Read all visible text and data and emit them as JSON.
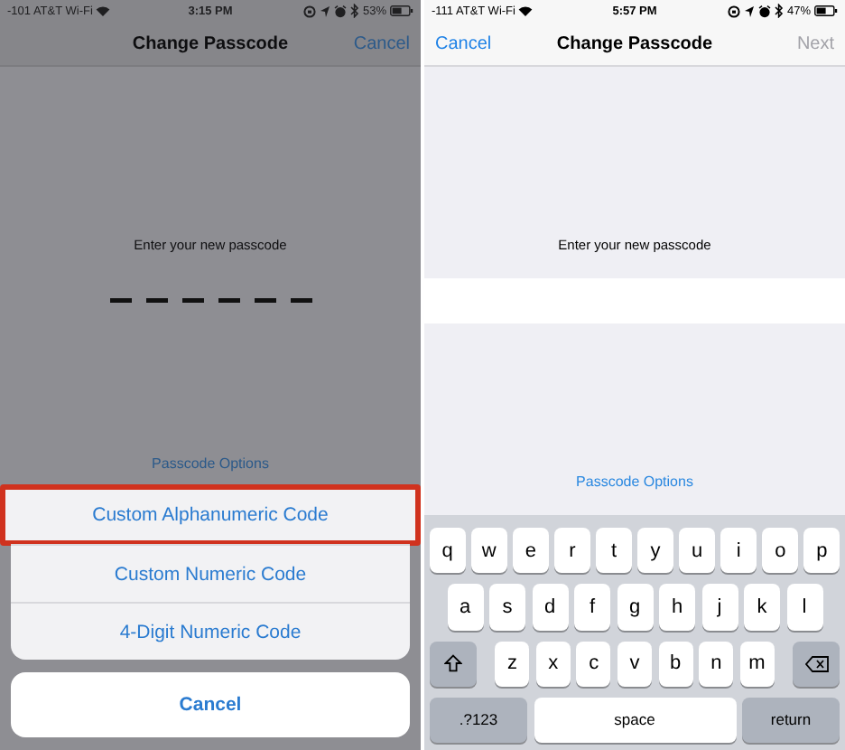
{
  "screens": [
    {
      "dimmed": true,
      "status_bar": {
        "carrier": "-101 AT&T Wi-Fi",
        "time": "3:15 PM",
        "battery": "53%",
        "icons": [
          {
            "kind": "rotation-lock"
          },
          {
            "kind": "location"
          },
          {
            "kind": "alarm"
          },
          {
            "kind": "bluetooth"
          }
        ]
      },
      "nav": {
        "title": "Change Passcode",
        "right_button": {
          "label": "Cancel",
          "disabled": false
        }
      },
      "prompt": "Enter your new passcode",
      "options_link": "Passcode Options",
      "action_sheet": {
        "options": [
          {
            "label": "Custom Alphanumeric Code",
            "highlighted": true
          },
          {
            "label": "Custom Numeric Code",
            "highlighted": false
          },
          {
            "label": "4-Digit Numeric Code",
            "highlighted": false
          }
        ],
        "cancel": "Cancel"
      }
    },
    {
      "dimmed": false,
      "status_bar": {
        "carrier": "-111 AT&T Wi-Fi",
        "time": "5:57 PM",
        "battery": "47%",
        "icons": [
          {
            "kind": "rotation-lock"
          },
          {
            "kind": "location"
          },
          {
            "kind": "alarm"
          },
          {
            "kind": "bluetooth"
          }
        ]
      },
      "nav": {
        "left_button": {
          "label": "Cancel",
          "disabled": false
        },
        "title": "Change Passcode",
        "right_button": {
          "label": "Next",
          "disabled": true
        }
      },
      "prompt": "Enter your new passcode",
      "options_link": "Passcode Options",
      "keyboard": {
        "rows": [
          {
            "keys": [
              {
                "kind": "letter",
                "label": "q"
              },
              {
                "kind": "letter",
                "label": "w"
              },
              {
                "kind": "letter",
                "label": "e"
              },
              {
                "kind": "letter",
                "label": "r"
              },
              {
                "kind": "letter",
                "label": "t"
              },
              {
                "kind": "letter",
                "label": "y"
              },
              {
                "kind": "letter",
                "label": "u"
              },
              {
                "kind": "letter",
                "label": "i"
              },
              {
                "kind": "letter",
                "label": "o"
              },
              {
                "kind": "letter",
                "label": "p"
              }
            ]
          },
          {
            "keys": [
              {
                "kind": "letter",
                "label": "a"
              },
              {
                "kind": "letter",
                "label": "s"
              },
              {
                "kind": "letter",
                "label": "d"
              },
              {
                "kind": "letter",
                "label": "f"
              },
              {
                "kind": "letter",
                "label": "g"
              },
              {
                "kind": "letter",
                "label": "h"
              },
              {
                "kind": "letter",
                "label": "j"
              },
              {
                "kind": "letter",
                "label": "k"
              },
              {
                "kind": "letter",
                "label": "l"
              }
            ]
          },
          {
            "keys": [
              {
                "kind": "shift"
              },
              {
                "kind": "letter",
                "label": "z"
              },
              {
                "kind": "letter",
                "label": "x"
              },
              {
                "kind": "letter",
                "label": "c"
              },
              {
                "kind": "letter",
                "label": "v"
              },
              {
                "kind": "letter",
                "label": "b"
              },
              {
                "kind": "letter",
                "label": "n"
              },
              {
                "kind": "letter",
                "label": "m"
              },
              {
                "kind": "delete"
              }
            ]
          },
          {
            "keys": [
              {
                "kind": "function",
                "label": ".?123"
              },
              {
                "kind": "space",
                "label": "space"
              },
              {
                "kind": "function",
                "label": "return"
              }
            ]
          }
        ]
      }
    }
  ]
}
